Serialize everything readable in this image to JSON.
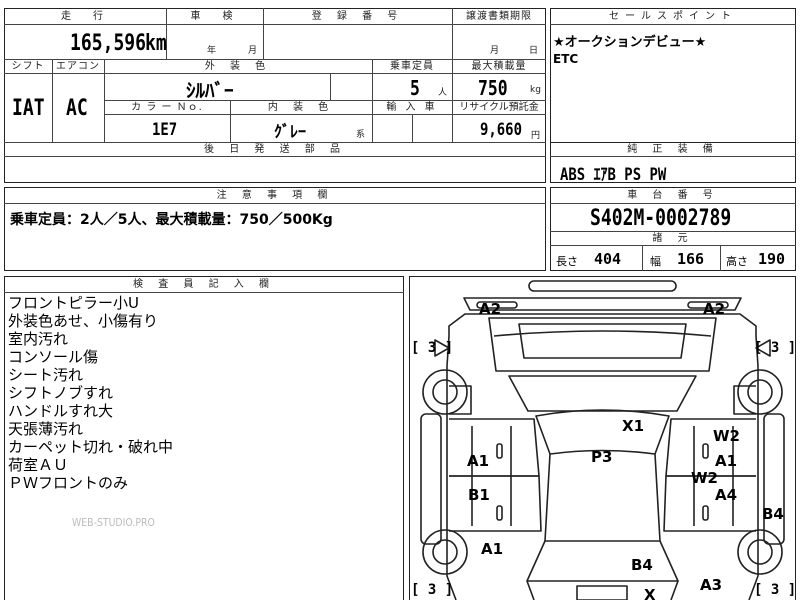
{
  "top_left": {
    "labels": {
      "mileage": "走　行",
      "inspection": "車　検",
      "registration": "登 録 番 号",
      "transfer_deadline": "譲渡書類期限",
      "shift": "シフト",
      "aircon": "エアコン",
      "exterior_color": "外 装 色",
      "capacity": "乗車定員",
      "max_load": "最大積載量",
      "color_no": "カ ラ ー  Ｎｏ.",
      "interior_color": "内 装 色",
      "import": "輸 入 車",
      "recycle": "リサイクル預託金",
      "later_parts": "後 日 発 送 部 品"
    },
    "mileage": "165,596",
    "mileage_unit": "km",
    "inspection_year": "年",
    "inspection_month": "月",
    "transfer_month": "月",
    "transfer_day": "日",
    "shift": "IAT",
    "aircon": "AC",
    "exterior_color": "ｼﾙﾊﾞｰ",
    "capacity": "5",
    "capacity_unit": "人",
    "max_load": "750",
    "max_load_unit": "kg",
    "color_no": "1E7",
    "interior_color": "ｸﾞﾚｰ",
    "interior_suffix": "系",
    "recycle_fee": "9,660",
    "recycle_unit": "円"
  },
  "sales_points": {
    "header": "セールスポイント",
    "lines": [
      "★オークションデビュー★",
      "ETC"
    ]
  },
  "equipment": {
    "header": "純 正 装 備",
    "value": "ABS ｴｱB PS PW"
  },
  "notes": {
    "header": "注 意 事 項 欄",
    "text": "乗車定員：2人／5人、最大積載量：750／500Kg"
  },
  "chassis": {
    "header": "車 台 番 号",
    "number": "S402M-0002789",
    "spec_header": "諸 元",
    "length_label": "長さ",
    "length": "404",
    "width_label": "幅",
    "width": "166",
    "height_label": "高さ",
    "height": "190"
  },
  "inspector": {
    "header": "検 査 員 記 入 欄",
    "remarks": [
      "フロントピラー小U",
      "外装色あせ、小傷有り",
      "室内汚れ",
      "コンソール傷",
      "シート汚れ",
      "シフトノブすれ",
      "ハンドルすれ大",
      "天張薄汚れ",
      "カーペット切れ・破れ中",
      "荷室ＡＵ",
      "ＰＷフロントのみ"
    ],
    "watermark": "WEB-STUDIO.PRO"
  },
  "diagram": {
    "tread_marks": [
      "[ 3 ]",
      "[ 3 ]",
      "[ 3 ]",
      "[ 3 ]"
    ],
    "marks": [
      "A2",
      "A2",
      "X1",
      "W2",
      "A1",
      "P3",
      "A1",
      "W2",
      "B1",
      "A4",
      "B4",
      "A1",
      "B4",
      "X",
      "A3"
    ]
  }
}
